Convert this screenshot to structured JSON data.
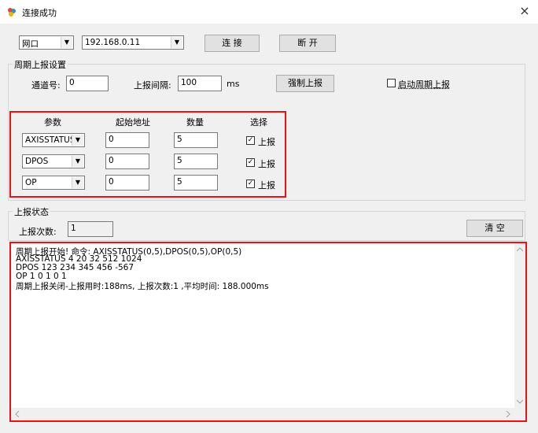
{
  "window": {
    "title": "连接成功",
    "close_glyph": "×"
  },
  "connection": {
    "type": "网口",
    "ip": "192.168.0.11",
    "connect_label": "连 接",
    "disconnect_label": "断 开"
  },
  "report_settings": {
    "group_label": "周期上报设置",
    "channel_label": "通道号:",
    "channel_value": "0",
    "interval_label": "上报间隔:",
    "interval_value": "100",
    "interval_unit": "ms",
    "force_report_label": "强制上报",
    "start_periodic_label": "启动周期上报"
  },
  "params": {
    "headers": {
      "param": "参数",
      "start_addr": "起始地址",
      "count": "数量",
      "select": "选择"
    },
    "rows": [
      {
        "param": "AXISSTATUS",
        "start": "0",
        "count": "5",
        "check": "✓",
        "label": "上报"
      },
      {
        "param": "DPOS",
        "start": "0",
        "count": "5",
        "check": "✓",
        "label": "上报"
      },
      {
        "param": "OP",
        "start": "0",
        "count": "5",
        "check": "✓",
        "label": "上报"
      }
    ]
  },
  "status": {
    "group_label": "上报状态",
    "count_label": "上报次数:",
    "count_value": "1",
    "clear_label": "清 空"
  },
  "log": {
    "lines": [
      "周期上报开始! 命令: AXISSTATUS(0,5),DPOS(0,5),OP(0,5)",
      "AXISSTATUS 4 20 32 512 1024",
      "DPOS 123 234 345 456 -567",
      "OP 1 0 1 0 1",
      "周期上报关闭-上报用时:188ms, 上报次数:1 ,平均时间: 188.000ms"
    ]
  },
  "icons": {
    "app": "app-icon",
    "dropdown": "chevron-down-icon",
    "scroll_up": "chevron-up-icon",
    "scroll_down": "chevron-down-icon",
    "scroll_left": "chevron-left-icon",
    "scroll_right": "chevron-right-icon"
  },
  "colors": {
    "highlight_border": "#e11111"
  }
}
